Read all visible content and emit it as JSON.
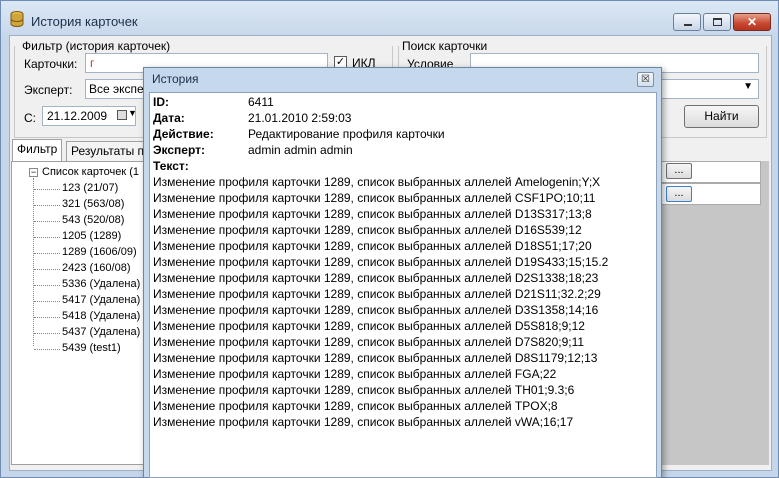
{
  "main_window": {
    "title": "История карточек"
  },
  "filter_group": {
    "label": "Фильтр (история карточек)",
    "cards_label": "Карточки:",
    "cards_value": "г",
    "ikl_label": "ИКЛ",
    "ikl_checked": true,
    "expert_label": "Эксперт:",
    "expert_value": "Все экспер",
    "from_label": "С:",
    "from_date": "21.12.2009"
  },
  "search_group": {
    "label": "Поиск карточки",
    "condition_label": "Условие",
    "find_button": "Найти"
  },
  "tabs": [
    {
      "label": "Фильтр"
    },
    {
      "label": "Результаты по"
    }
  ],
  "tree": {
    "root": "Список карточек (1",
    "items": [
      "123 (21/07)",
      "321 (563/08)",
      "543 (520/08)",
      "1205 (1289)",
      "1289 (1606/09)",
      "2423 (160/08)",
      "5336 (Удалена)",
      "5417 (Удалена)",
      "5418 (Удалена)",
      "5437 (Удалена)",
      "5439 (test1)"
    ]
  },
  "dots_buttons": [
    "...",
    "..."
  ],
  "dialog": {
    "title": "История",
    "close_glyph": "☒",
    "fields": [
      {
        "label": "ID:",
        "value": "6411"
      },
      {
        "label": "Дата:",
        "value": "21.01.2010 2:59:03"
      },
      {
        "label": "Действие:",
        "value": "Редактирование профиля карточки"
      },
      {
        "label": "Эксперт:",
        "value": "admin admin admin"
      },
      {
        "label": "Текст:",
        "value": ""
      }
    ],
    "lines": [
      "Изменение профиля карточки 1289, список выбранных аллелей Amelogenin;Y;X",
      "Изменение профиля карточки 1289, список выбранных аллелей CSF1PO;10;11",
      "Изменение профиля карточки 1289, список выбранных аллелей D13S317;13;8",
      "Изменение профиля карточки 1289, список выбранных аллелей D16S539;12",
      "Изменение профиля карточки 1289, список выбранных аллелей D18S51;17;20",
      "Изменение профиля карточки 1289, список выбранных аллелей D19S433;15;15.2",
      "Изменение профиля карточки 1289, список выбранных аллелей D2S1338;18;23",
      "Изменение профиля карточки 1289, список выбранных аллелей D21S11;32.2;29",
      "Изменение профиля карточки 1289, список выбранных аллелей D3S1358;14;16",
      "Изменение профиля карточки 1289, список выбранных аллелей D5S818;9;12",
      "Изменение профиля карточки 1289, список выбранных аллелей D7S820;9;11",
      "Изменение профиля карточки 1289, список выбранных аллелей D8S1179;12;13",
      "Изменение профиля карточки 1289, список выбранных аллелей FGA;22",
      "Изменение профиля карточки 1289, список выбранных аллелей TH01;9.3;6",
      "Изменение профиля карточки 1289, список выбранных аллелей TPOX;8",
      "Изменение профиля карточки 1289, список выбранных аллелей vWA;16;17"
    ]
  }
}
